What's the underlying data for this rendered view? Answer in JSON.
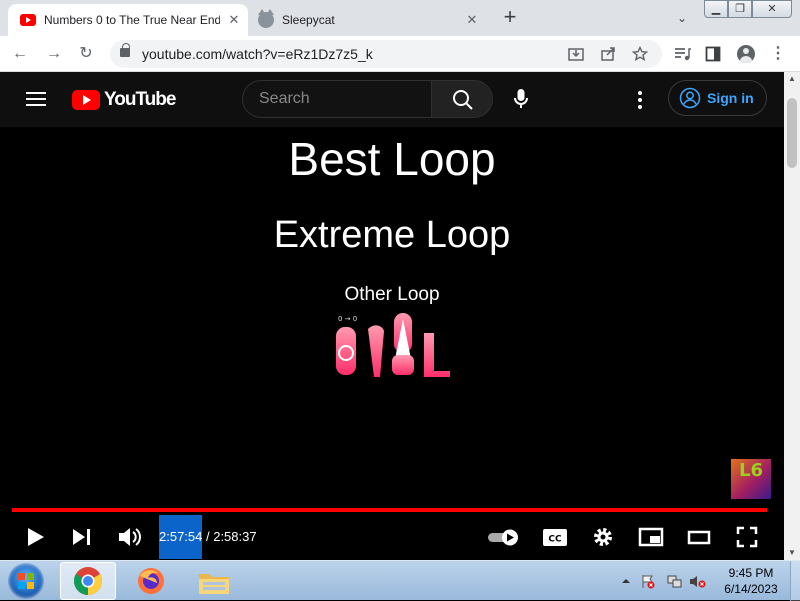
{
  "browser": {
    "tabs": [
      {
        "title": "Numbers 0 to The True Near End",
        "favicon": "youtube-favicon",
        "active": true
      },
      {
        "title": "Sleepycat",
        "favicon": "cat-favicon",
        "active": false
      }
    ],
    "url": "youtube.com/watch?v=eRz1Dz7z5_k"
  },
  "youtube": {
    "logo_text": "YouTube",
    "search_placeholder": "Search",
    "signin_label": "Sign in"
  },
  "video": {
    "lines": [
      "Best Loop",
      "Extreme Loop",
      "Other Loop"
    ],
    "figure_label": "0 → 0",
    "channel_badge": "L6",
    "progress_fraction": 0.996,
    "time_current": "2:57:54",
    "time_separator": " / ",
    "time_total": "2:58:37"
  },
  "taskbar": {
    "time": "9:45 PM",
    "date": "6/14/2023",
    "pinned": [
      "chrome-icon",
      "firefox-icon",
      "file-explorer-icon"
    ]
  },
  "colors": {
    "yt_red": "#ff0000",
    "link_blue": "#3ea6ff",
    "tab_bg": "#dee1e6"
  }
}
